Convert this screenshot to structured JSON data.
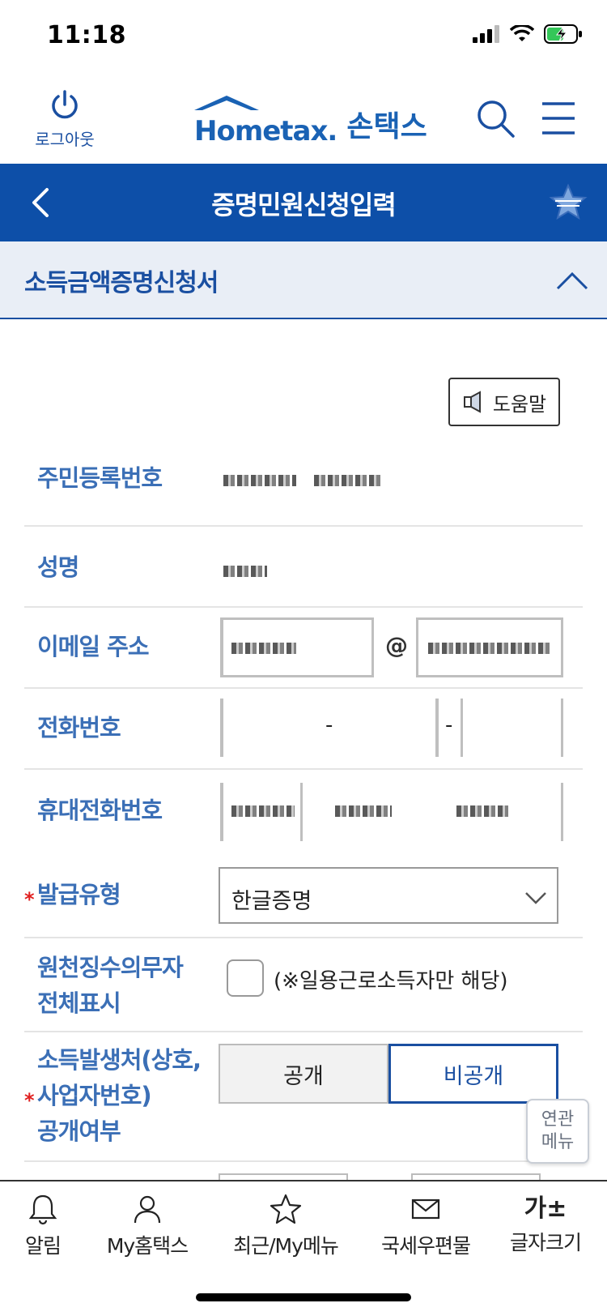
{
  "status_bar": {
    "time": "11:18"
  },
  "header": {
    "logout_label": "로그아웃",
    "logo_text": "Hometax.",
    "logo_ko": "손택스"
  },
  "title_bar": {
    "title": "증명민원신청입력"
  },
  "section": {
    "title": "소득금액증명신청서"
  },
  "help": {
    "label": "도움말"
  },
  "form": {
    "rows": {
      "resident_no": {
        "label": "주민등록번호"
      },
      "name": {
        "label": "성명"
      },
      "email": {
        "label": "이메일 주소",
        "at": "@"
      },
      "phone": {
        "label": "전화번호",
        "dash1": "-",
        "dash2": "-"
      },
      "mobile": {
        "label": "휴대전화번호"
      },
      "issue_type": {
        "label": "발급유형",
        "required": "*",
        "selected": "한글증명"
      },
      "withholding": {
        "label_line1": "원천징수의무자",
        "label_line2": "전체표시",
        "note": "(※일용근로소득자만 해당)"
      },
      "disclosure": {
        "required": "*",
        "label_line1": "소득발생처(상호,",
        "label_line2": "사업자번호)",
        "label_line3": "공개여부",
        "option_public": "공개",
        "option_private": "비공개",
        "selected": "비공개"
      }
    }
  },
  "related_menu": {
    "line1": "연관",
    "line2": "메뉴"
  },
  "bottom_nav": {
    "items": [
      {
        "label": "알림",
        "icon": "bell-icon"
      },
      {
        "label": "My홈택스",
        "icon": "person-icon"
      },
      {
        "label": "최근/My메뉴",
        "icon": "star-icon"
      },
      {
        "label": "국세우편물",
        "icon": "mail-icon"
      },
      {
        "label": "글자크기",
        "icon": "font-size-icon",
        "glyph": "가±"
      }
    ]
  },
  "colors": {
    "primary": "#0d4fa8",
    "label": "#3b6fb6",
    "required": "#e02020"
  }
}
